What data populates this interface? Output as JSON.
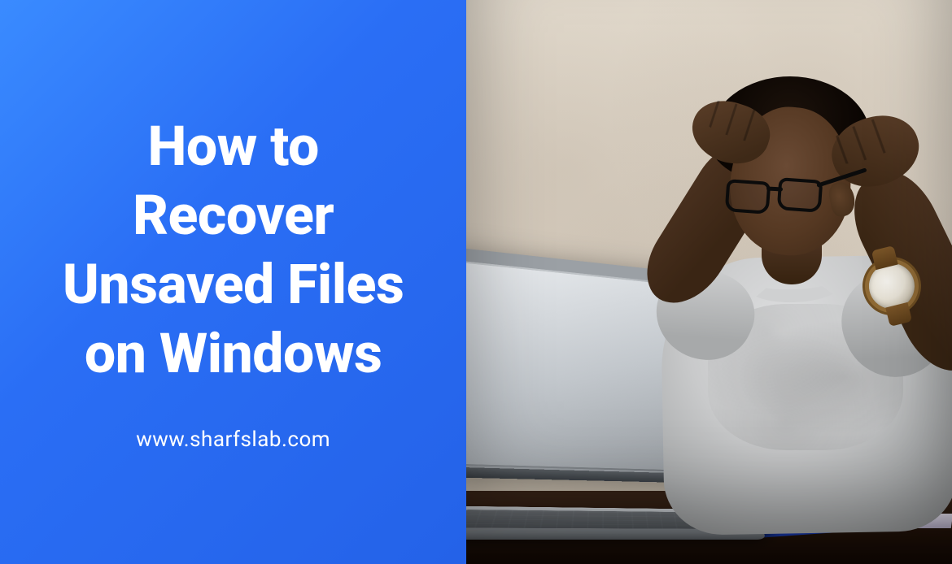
{
  "banner": {
    "headline": "How to\nRecover\nUnsaved Files\non Windows",
    "website": "www.sharfslab.com"
  },
  "colors": {
    "panel_gradient_start": "#3a8bff",
    "panel_gradient_end": "#2462e8",
    "text": "#ffffff"
  },
  "image": {
    "description": "A frustrated young man wearing glasses and a grey t-shirt sits at a desk holding his head with both hands while looking at an open silver laptop. He wears a brown leather-strap wristwatch. A blue pen and papers rest on the dark wooden desk against a mottled beige wall.",
    "objects": {
      "laptop": "silver-laptop",
      "watch": "brown-strap-watch",
      "pen": "blue-pen",
      "glasses": "black-rectangular-glasses",
      "shirt": "grey-t-shirt"
    }
  }
}
